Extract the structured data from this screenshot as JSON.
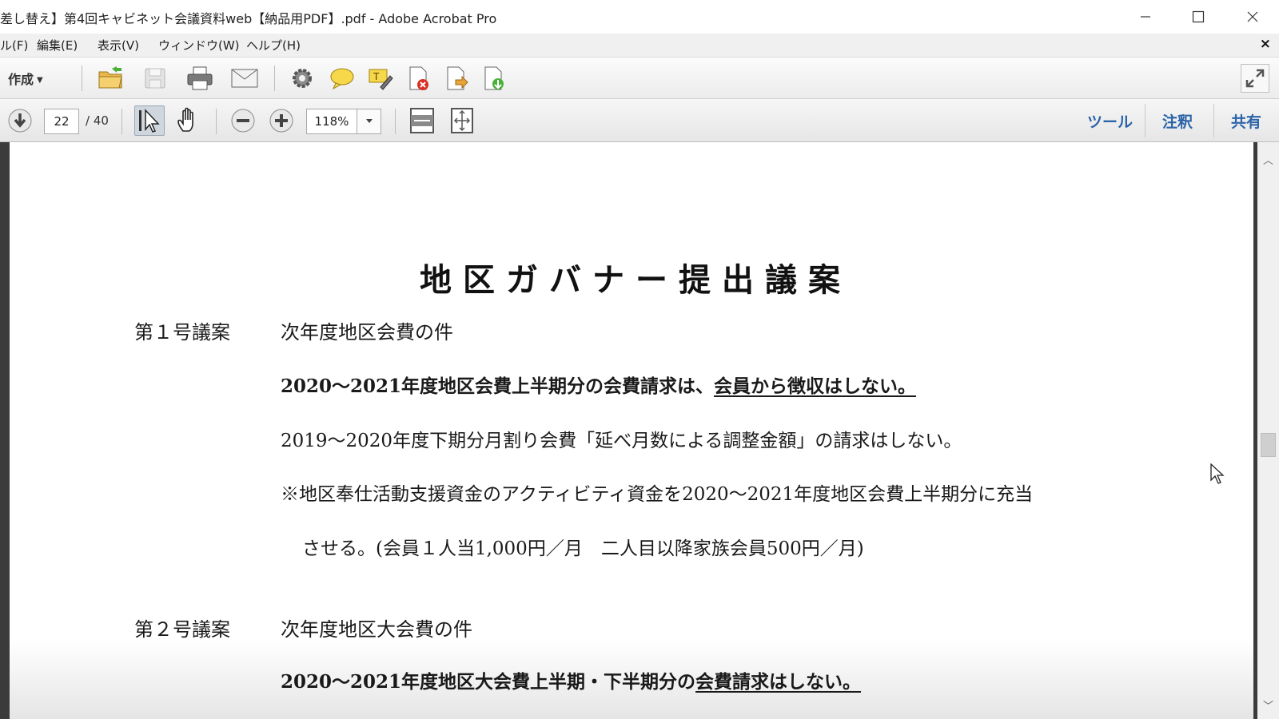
{
  "window": {
    "title": "差し替え】第4回キャビネット会議資料web【納品用PDF】.pdf - Adobe Acrobat Pro"
  },
  "menu": {
    "items": [
      "ル(F)",
      "編集(E)",
      "表示(V)",
      "ウィンドウ(W)",
      "ヘルプ(H)"
    ],
    "close_glyph": "×"
  },
  "toolbar": {
    "create_label": "作成",
    "icons": [
      "open-icon",
      "save-icon",
      "print-icon",
      "email-icon",
      "settings-icon",
      "comment-icon",
      "highlight-icon",
      "delete-page-icon",
      "export-icon",
      "insert-icon",
      "fullscreen-icon"
    ]
  },
  "nav": {
    "current_page": "22",
    "total_pages": "/ 40",
    "zoom": "118%"
  },
  "panes": {
    "tools": "ツール",
    "comment": "注釈",
    "share": "共有"
  },
  "document": {
    "title": "地区ガバナー提出議案",
    "agenda1": {
      "number": "第１号議案",
      "subject": "次年度地区会費の件",
      "line1_pre": "2020～2021年度地区会費上半期分の会費請求は、",
      "line1_ul": "会員から徴収はしない。",
      "line2": "2019～2020年度下期分月割り会費「延べ月数による調整金額」の請求はしない。",
      "line3": "※地区奉仕活動支援資金のアクティビティ資金を2020～2021年度地区会費上半期分に充当",
      "line4": "させる。(会員１人当1,000円／月　二人目以降家族会員500円／月)"
    },
    "agenda2": {
      "number": "第２号議案",
      "subject": "次年度地区大会費の件",
      "line1_pre": "2020～2021年度地区大会費上半期・下半期分の",
      "line1_ul": "会費請求はしない。"
    }
  },
  "colors": {
    "pane_link": "#2c64a8",
    "menubar_bg": "#f0f0f0"
  }
}
